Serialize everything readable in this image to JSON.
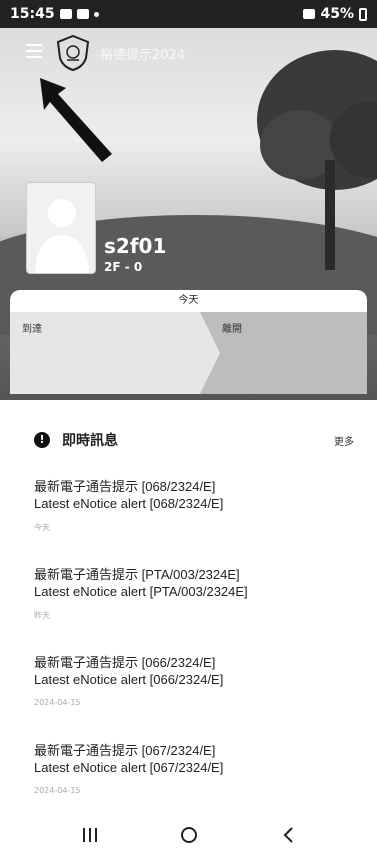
{
  "status": {
    "time": "15:45",
    "battery": "45%"
  },
  "header": {
    "school_name": "裕德提示2024"
  },
  "profile": {
    "name": "s2f01",
    "class": "2F - 0"
  },
  "attendance": {
    "today_label": "今天",
    "in_label": "到達",
    "out_label": "離開"
  },
  "messages": {
    "title": "即時訊息",
    "more": "更多",
    "items": [
      {
        "line1": "最新電子通告提示 [068/2324/E]",
        "line2": "Latest eNotice alert [068/2324/E]",
        "date": "今天"
      },
      {
        "line1": "最新電子通告提示 [PTA/003/2324E]",
        "line2": "Latest eNotice alert [PTA/003/2324E]",
        "date": "昨天"
      },
      {
        "line1": "最新電子通告提示 [066/2324/E]",
        "line2": "Latest eNotice alert [066/2324/E]",
        "date": "2024-04-15"
      },
      {
        "line1": "最新電子通告提示 [067/2324/E]",
        "line2": "Latest eNotice alert [067/2324/E]",
        "date": "2024-04-15"
      }
    ]
  },
  "icons": {
    "menu": "hamburger-menu-icon",
    "logo": "school-crest-icon",
    "message": "exclamation-bubble-icon",
    "nav_recent": "recent-apps-icon",
    "nav_home": "home-icon",
    "nav_back": "back-icon"
  }
}
